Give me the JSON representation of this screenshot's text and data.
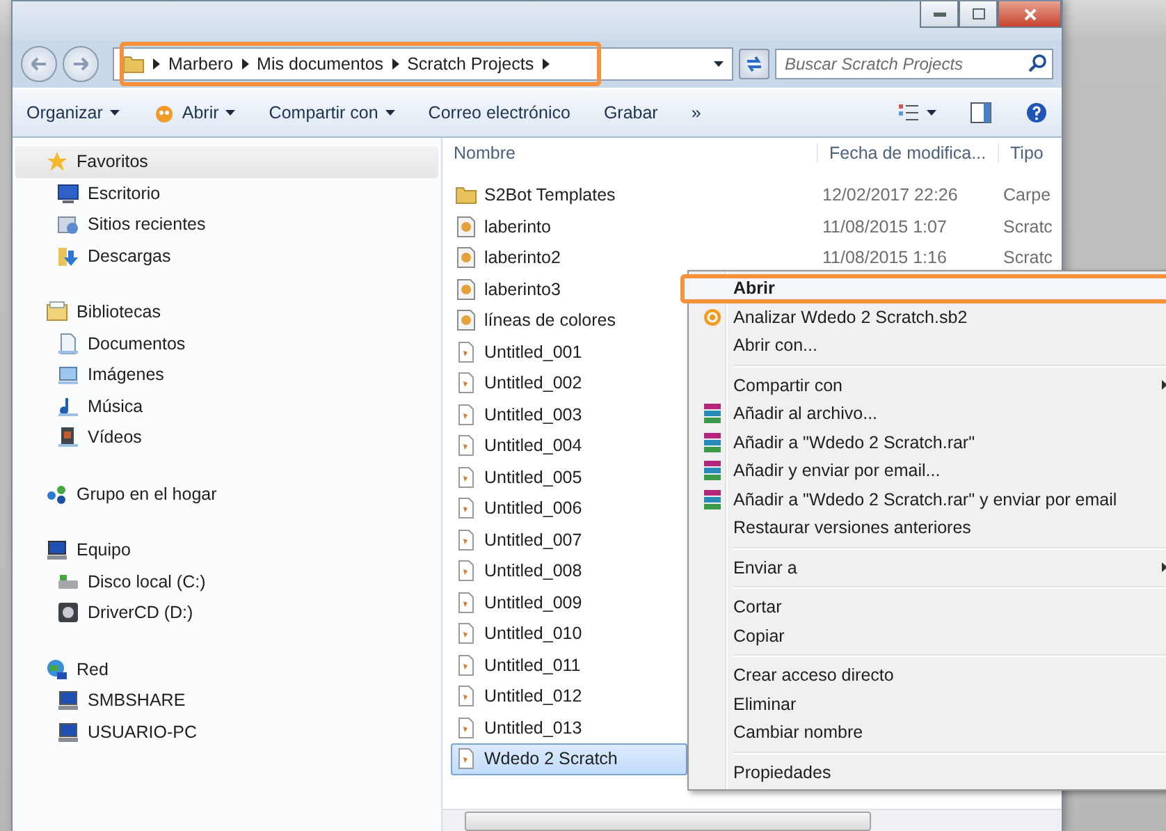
{
  "address_bar": {
    "crumbs": [
      "Marbero",
      "Mis documentos",
      "Scratch Projects"
    ]
  },
  "search": {
    "placeholder": "Buscar Scratch Projects"
  },
  "toolbar": [
    {
      "label": "Organizar",
      "dropdown": true
    },
    {
      "label": "Abrir",
      "dropdown": true
    },
    {
      "label": "Compartir con",
      "dropdown": true
    },
    {
      "label": "Correo electrónico",
      "dropdown": false
    },
    {
      "label": "Grabar",
      "dropdown": false
    },
    {
      "label": "»",
      "dropdown": false
    }
  ],
  "sidebar": {
    "groups": [
      {
        "label": "Favoritos",
        "selected": true,
        "children": [
          {
            "label": "Escritorio"
          },
          {
            "label": "Sitios recientes"
          },
          {
            "label": "Descargas"
          }
        ]
      },
      {
        "label": "Bibliotecas",
        "selected": false,
        "children": [
          {
            "label": "Documentos"
          },
          {
            "label": "Imágenes"
          },
          {
            "label": "Música"
          },
          {
            "label": "Vídeos"
          }
        ]
      },
      {
        "label": "Grupo en el hogar",
        "selected": false
      },
      {
        "label": "Equipo",
        "selected": false,
        "children": [
          {
            "label": "Disco local (C:)"
          },
          {
            "label": "DriverCD (D:)"
          }
        ]
      },
      {
        "label": "Red",
        "selected": false,
        "children": [
          {
            "label": "SMBSHARE"
          },
          {
            "label": "USUARIO-PC"
          }
        ]
      }
    ]
  },
  "columns": [
    "Nombre",
    "Fecha de modifica...",
    "Tipo"
  ],
  "files": [
    {
      "name": "S2Bot Templates",
      "kind": "folder",
      "date": "12/02/2017 22:26",
      "type": "Carpe",
      "selected": false
    },
    {
      "name": "laberinto",
      "kind": "project",
      "date": "11/08/2015 1:07",
      "type": "Scratc",
      "selected": false
    },
    {
      "name": "laberinto2",
      "kind": "project",
      "date": "11/08/2015 1:16",
      "type": "Scratc",
      "selected": false
    },
    {
      "name": "laberinto3",
      "kind": "project",
      "selected": false
    },
    {
      "name": "líneas de colores",
      "kind": "project",
      "selected": false
    },
    {
      "name": "Untitled_001",
      "kind": "untitled",
      "selected": false
    },
    {
      "name": "Untitled_002",
      "kind": "untitled",
      "selected": false
    },
    {
      "name": "Untitled_003",
      "kind": "untitled",
      "selected": false
    },
    {
      "name": "Untitled_004",
      "kind": "untitled",
      "selected": false
    },
    {
      "name": "Untitled_005",
      "kind": "untitled",
      "selected": false
    },
    {
      "name": "Untitled_006",
      "kind": "untitled",
      "selected": false
    },
    {
      "name": "Untitled_007",
      "kind": "untitled",
      "selected": false
    },
    {
      "name": "Untitled_008",
      "kind": "untitled",
      "selected": false
    },
    {
      "name": "Untitled_009",
      "kind": "untitled",
      "selected": false
    },
    {
      "name": "Untitled_010",
      "kind": "untitled",
      "selected": false
    },
    {
      "name": "Untitled_011",
      "kind": "untitled",
      "selected": false
    },
    {
      "name": "Untitled_012",
      "kind": "untitled",
      "selected": false
    },
    {
      "name": "Untitled_013",
      "kind": "untitled",
      "selected": false
    },
    {
      "name": "Wdedo 2 Scratch",
      "kind": "untitled",
      "selected": true
    }
  ],
  "context_menu": {
    "groups": [
      [
        {
          "label": "Abrir",
          "kind": "default",
          "submenu": false,
          "highlighted": true
        },
        {
          "label": "Analizar Wdedo 2 Scratch.sb2",
          "kind": "scan",
          "submenu": false
        },
        {
          "label": "Abrir con...",
          "kind": "plain",
          "submenu": false
        }
      ],
      [
        {
          "label": "Compartir con",
          "kind": "plain",
          "submenu": true
        },
        {
          "label": "Añadir al archivo...",
          "kind": "archive",
          "submenu": false
        },
        {
          "label": "Añadir a \"Wdedo 2 Scratch.rar\"",
          "kind": "archive",
          "submenu": false
        },
        {
          "label": "Añadir y enviar por email...",
          "kind": "archive",
          "submenu": false
        },
        {
          "label": "Añadir a \"Wdedo 2 Scratch.rar\" y enviar por email",
          "kind": "archive",
          "submenu": false
        },
        {
          "label": "Restaurar versiones anteriores",
          "kind": "plain",
          "submenu": false
        }
      ],
      [
        {
          "label": "Enviar a",
          "kind": "plain",
          "submenu": true
        }
      ],
      [
        {
          "label": "Cortar",
          "kind": "plain",
          "submenu": false
        },
        {
          "label": "Copiar",
          "kind": "plain",
          "submenu": false
        }
      ],
      [
        {
          "label": "Crear acceso directo",
          "kind": "plain",
          "submenu": false
        },
        {
          "label": "Eliminar",
          "kind": "plain",
          "submenu": false
        },
        {
          "label": "Cambiar nombre",
          "kind": "plain",
          "submenu": false
        }
      ],
      [
        {
          "label": "Propiedades",
          "kind": "plain",
          "submenu": false
        }
      ]
    ]
  }
}
